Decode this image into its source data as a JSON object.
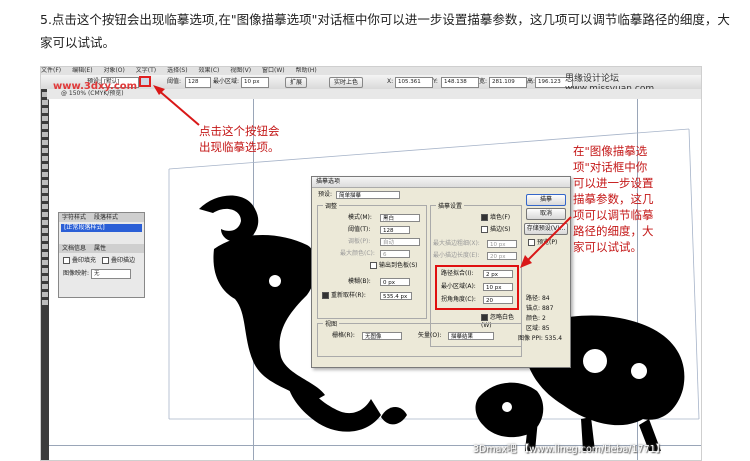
{
  "intro_text": "5.点击这个按钮会出现临摹选项,在\"图像描摹选项\"对话框中你可以进一步设置描摹参数，这几项可以调节临摹路径的细度，大家可以试试。",
  "app": {
    "menus": [
      "文件(F)",
      "编辑(E)",
      "对象(O)",
      "文字(T)",
      "选择(S)",
      "效果(C)",
      "视图(V)",
      "窗口(W)",
      "帮助(H)"
    ],
    "ctrl": {
      "preset_label": "预设:",
      "preset_value": "[默认]",
      "threshold_label": "阈值:",
      "threshold_value": "128",
      "min_area_label": "最小区域:",
      "min_area_value": "10 px",
      "expand_btn": "扩展",
      "live_paint_btn": "实时上色",
      "x_label": "X:",
      "x_value": "105.361 mm",
      "y_label": "Y:",
      "y_value": "148.138 mm",
      "w_label": "宽:",
      "w_value": "281.109 mm",
      "h_label": "高:",
      "h_value": "196.123 mm"
    },
    "doc_tab": "@ 150% (CMYK/预览)",
    "watermark_left": "www.3dxy.com",
    "watermark_right": "思缘设计论坛 www.missyuan.com"
  },
  "panel": {
    "tab1": "字符样式",
    "tab2": "段落样式",
    "selected_style": "[正常段落样式]",
    "tab3": "文档信息",
    "tab4": "属性",
    "overprint_fill": "叠印填充",
    "overprint_stroke": "叠印描边",
    "image_map_label": "图像映射:",
    "image_map_value": "无"
  },
  "dialog": {
    "title": "描摹选项",
    "preset_label": "预设:",
    "preset_value": "简单描摹",
    "adjust_group": "调整",
    "mode_label": "模式(M):",
    "mode_value": "黑白",
    "threshold_label": "阈值(T):",
    "threshold_value": "128",
    "palette_label": "调板(P):",
    "palette_value": "自动",
    "max_colors_label": "最大颜色(C):",
    "max_colors_value": "6",
    "output_swatches": "输出到色板(S)",
    "blur_label": "模糊(B):",
    "blur_value": "0 px",
    "resample_label": "重新取样(R):",
    "resample_value": "535.4 px",
    "trace_group": "描摹设置",
    "fills": "填色(F)",
    "strokes": "描边(S)",
    "max_stroke_label": "最大描边粗细(X):",
    "max_stroke_value": "10 px",
    "min_stroke_label": "最小描边长度(E):",
    "min_stroke_value": "20 px",
    "path_fit_label": "路径拟合(I):",
    "path_fit_value": "2 px",
    "min_area_label": "最小区域(A):",
    "min_area_value": "10 px",
    "corner_label": "拐角角度(C):",
    "corner_value": "20",
    "ignore_white": "忽略白色(W)",
    "view_group": "视图",
    "raster_label": "栅格(R):",
    "raster_value": "无图像",
    "vector_label": "矢量(O):",
    "vector_value": "描摹结果",
    "btn_trace": "描摹",
    "btn_cancel": "取消",
    "btn_save_preset": "存储预设(V)...",
    "preview": "预览(P)",
    "stats_paths_label": "路径:",
    "stats_paths": "84",
    "stats_anchors_label": "锚点:",
    "stats_anchors": "887",
    "stats_colors_label": "颜色:",
    "stats_colors": "2",
    "stats_areas_label": "区域:",
    "stats_areas": "85",
    "stats_ppi_label": "图像 PPI:",
    "stats_ppi": "535.4"
  },
  "annotations": {
    "left_line1": "点击这个按钮会",
    "left_line2": "出现临摹选项。",
    "right_lines": [
      "在\"图像描摹选",
      "项\"对话框中你",
      "可以进一步设置",
      "描摹参数，这几",
      "项可以调节临摹",
      "路径的细度，大",
      "家可以试试。"
    ]
  },
  "bottom_watermark": "3Dmax吧 【www.lineg.com/tieba/1771】",
  "colors": {
    "annotation_red": "#c41717",
    "highlight_red": "#e01010",
    "selection_blue": "#2b5fd6"
  }
}
